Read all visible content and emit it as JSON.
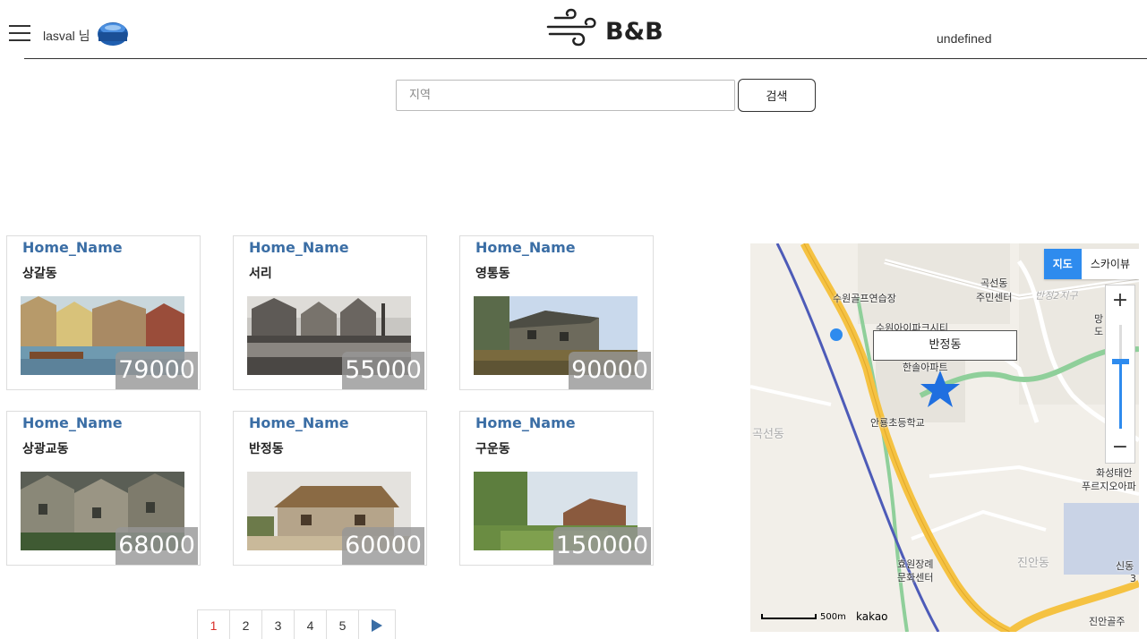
{
  "header": {
    "username": "lasval 님",
    "logo_text": "B&B",
    "right_text": "undefined"
  },
  "search": {
    "placeholder": "지역",
    "button_label": "검색"
  },
  "listings": [
    {
      "home_name": "Home_Name",
      "region": "상갈동",
      "price": "79000"
    },
    {
      "home_name": "Home_Name",
      "region": "서리",
      "price": "55000"
    },
    {
      "home_name": "Home_Name",
      "region": "영통동",
      "price": "90000"
    },
    {
      "home_name": "Home_Name",
      "region": "상광교동",
      "price": "68000"
    },
    {
      "home_name": "Home_Name",
      "region": "반정동",
      "price": "60000"
    },
    {
      "home_name": "Home_Name",
      "region": "구운동",
      "price": "150000"
    }
  ],
  "pagination": {
    "pages": [
      "1",
      "2",
      "3",
      "4",
      "5"
    ],
    "current": "1"
  },
  "map": {
    "type_map": "지도",
    "type_sky": "스카이뷰",
    "zoom_in": "+",
    "zoom_out": "−",
    "marker_label": "반정동",
    "scale": "500m",
    "brand": "kakao",
    "places": {
      "p1": "곡선동",
      "p2": "주민센터",
      "p3": "수원골프연습장",
      "p4": "반정2지구",
      "p5": "수원아이파크시티",
      "p6": "한솔아파트",
      "p7": "안룡초등학교",
      "p8": "곡선동",
      "p9": "화성태안",
      "p10": "푸르지오아파",
      "p11": "효원장례",
      "p12": "문화센터",
      "p13": "진안동",
      "p14": "신동",
      "p15": "진안골주",
      "p16": "망",
      "p17": "도",
      "p18": "3"
    },
    "colors": {
      "highway": "#f5c242",
      "rail": "#4d5bb8",
      "river": "#8fcf9a",
      "marker": "#1f6fe0"
    }
  }
}
